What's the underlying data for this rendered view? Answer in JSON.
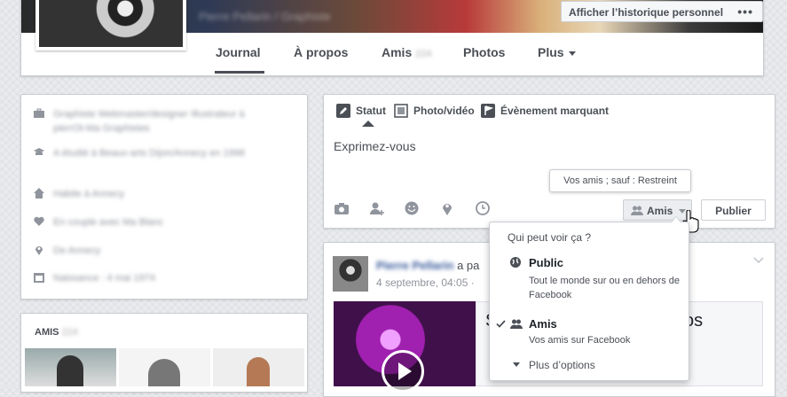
{
  "header": {
    "cover_blur_text": "Pierre Pellarin / Graphiste",
    "history_button": "Afficher l’historique personnel",
    "history_more": "•••",
    "tabs": [
      {
        "label": "Journal"
      },
      {
        "label": "À propos"
      },
      {
        "label": "Amis",
        "count": "224"
      },
      {
        "label": "Photos"
      },
      {
        "label": "Plus"
      }
    ]
  },
  "intro": {
    "items": [
      {
        "icon": "briefcase-icon",
        "text": "Graphiste Webmaster/designer Illustrateur à pierrOt-Ma Graphistes"
      },
      {
        "icon": "graduation-cap-icon",
        "text": "A étudié à Beaux-arts Dijon/Annecy en 1998"
      },
      {
        "icon": "home-icon",
        "text": "Habite à Annecy"
      },
      {
        "icon": "heart-icon",
        "text": "En couple avec Ma Blanc"
      },
      {
        "icon": "location-pin-icon",
        "text": "De Annecy"
      },
      {
        "icon": "calendar-icon",
        "text": "Naissance : 4 mai 1974"
      }
    ]
  },
  "friends": {
    "title": "AMIS",
    "count": "224"
  },
  "composer": {
    "tabs": [
      {
        "label": "Statut"
      },
      {
        "label": "Photo/vidéo"
      },
      {
        "label": "Évènement marquant"
      }
    ],
    "placeholder": "Exprimez-vous",
    "audience_tooltip": "Vos amis ; sauf : Restreint",
    "audience_button": "Amis",
    "publish_button": "Publier"
  },
  "audience_menu": {
    "header": "Qui peut voir ça ?",
    "options": [
      {
        "title": "Public",
        "desc": "Tout le monde sur ou en dehors de Facebook",
        "selected": false
      },
      {
        "title": "Amis",
        "desc": "Vos amis sur Facebook",
        "selected": true
      }
    ],
    "more": "Plus d’options"
  },
  "post": {
    "author": "Pierre Pellarin",
    "action": "a pa",
    "date": "4 septembre, 04:05 ·",
    "link_title_fragment": "S",
    "link_title_end": "os"
  },
  "colors": {
    "accent": "#4b4f56",
    "link": "#365899",
    "border": "#c9ccd1"
  }
}
